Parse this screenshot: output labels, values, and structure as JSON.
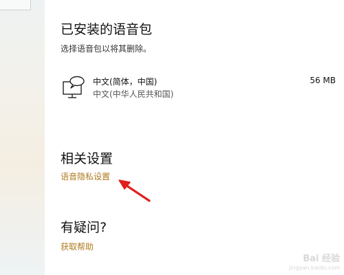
{
  "sidebar": {
    "search_icon": "search-icon"
  },
  "installed_packs": {
    "title": "已安装的语音包",
    "description": "选择语音包以将其删除。",
    "items": [
      {
        "icon": "speech-monitor-icon",
        "name": "中文(简体，中国)",
        "sub": "中文(中华人民共和国)",
        "size": "56 MB"
      }
    ]
  },
  "related": {
    "title": "相关设置",
    "link": "语音隐私设置"
  },
  "help": {
    "title": "有疑问?",
    "link": "获取帮助"
  },
  "watermark": {
    "text": "Bai 经验",
    "url": "jingyan.baidu.com"
  },
  "colors": {
    "link": "#b07a1f",
    "annotation_arrow": "#e0201b"
  }
}
